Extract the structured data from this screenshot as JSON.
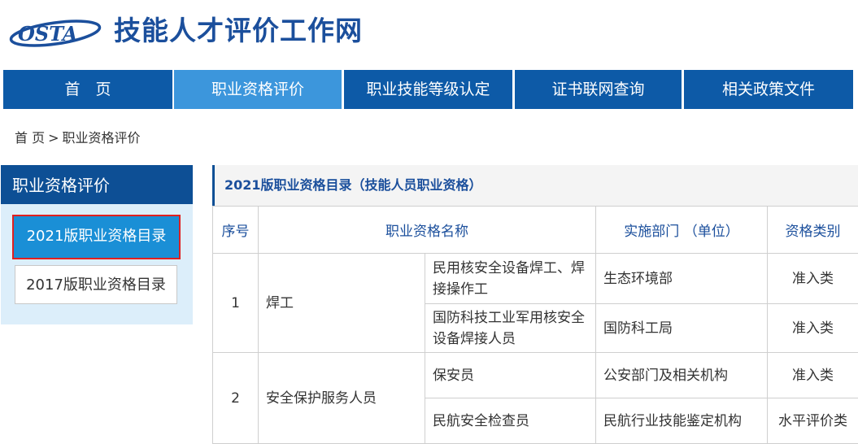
{
  "site": {
    "logo_text": "OSTA",
    "title": "技能人才评价工作网"
  },
  "nav": [
    {
      "label": "首　页"
    },
    {
      "label": "职业资格评价"
    },
    {
      "label": "职业技能等级认定"
    },
    {
      "label": "证书联网查询"
    },
    {
      "label": "相关政策文件"
    }
  ],
  "breadcrumb": {
    "home": "首 页",
    "sep": ">",
    "current": "职业资格评价"
  },
  "sidebar": {
    "heading": "职业资格评价",
    "items": [
      {
        "label": "2021版职业资格目录"
      },
      {
        "label": "2017版职业资格目录"
      }
    ]
  },
  "content": {
    "title": "2021版职业资格目录（技能人员职业资格）",
    "headers": {
      "no": "序号",
      "name": "职业资格名称",
      "dept": "实施部门 （单位）",
      "category": "资格类别"
    },
    "groups": [
      {
        "no": "1",
        "name": "焊工",
        "rows": [
          {
            "sub": "民用核安全设备焊工、焊接操作工",
            "dept": "生态环境部",
            "category": "准入类"
          },
          {
            "sub": "国防科技工业军用核安全设备焊接人员",
            "dept": "国防科工局",
            "category": "准入类"
          }
        ]
      },
      {
        "no": "2",
        "name": "安全保护服务人员",
        "rows": [
          {
            "sub": "保安员",
            "dept": "公安部门及相关机构",
            "category": "准入类"
          },
          {
            "sub": "民航安全检查员",
            "dept": "民航行业技能鉴定机构",
            "category": "水平评价类"
          }
        ]
      }
    ]
  }
}
